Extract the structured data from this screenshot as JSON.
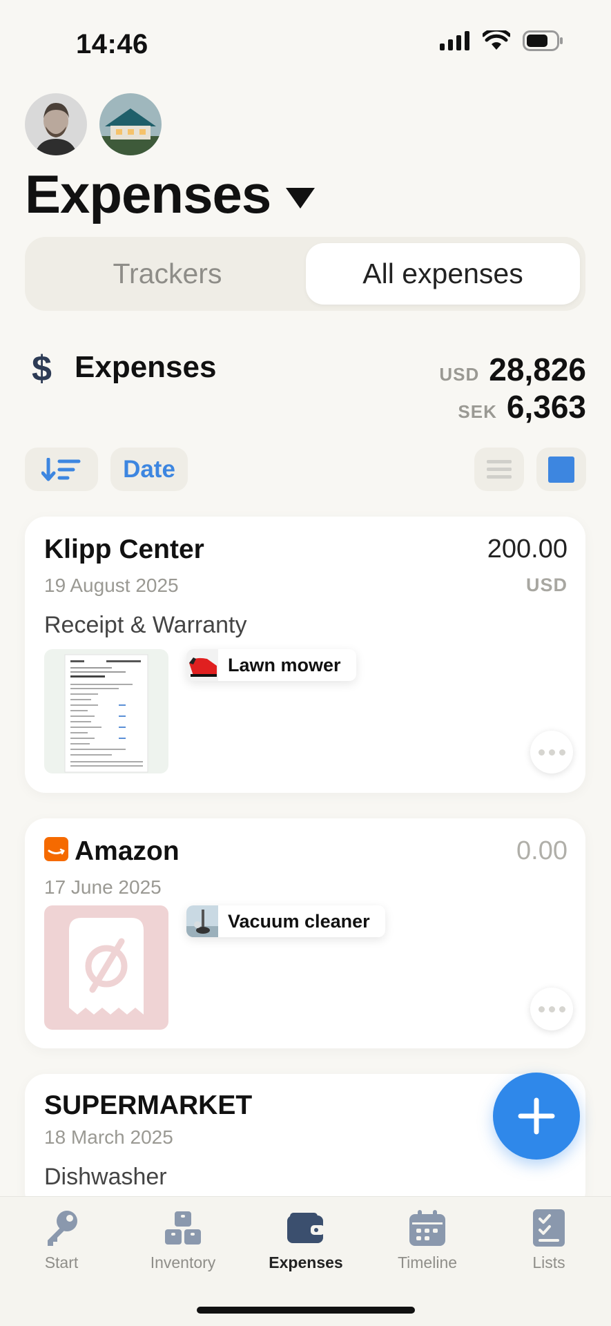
{
  "status_bar": {
    "time": "14:46"
  },
  "header": {
    "title": "Expenses"
  },
  "segments": {
    "trackers": "Trackers",
    "all_expenses": "All expenses",
    "active": "all_expenses"
  },
  "summary": {
    "icon": "dollar-icon",
    "label": "Expenses",
    "totals": [
      {
        "currency": "USD",
        "amount": "28,826"
      },
      {
        "currency": "SEK",
        "amount": "6,363"
      }
    ]
  },
  "controls": {
    "sort_icon": "sort-descending-icon",
    "sort_label": "Date",
    "view_list_icon": "list-view-icon",
    "view_grid_icon": "grid-view-icon"
  },
  "expenses": [
    {
      "merchant": "Klipp Center",
      "date": "19 August 2025",
      "amount": "200.00",
      "currency": "USD",
      "note": "Receipt & Warranty",
      "tag": "Lawn mower"
    },
    {
      "merchant": "Amazon",
      "date": "17 June 2025",
      "amount": "0.00",
      "currency": "",
      "note": "",
      "tag": "Vacuum cleaner"
    },
    {
      "merchant": "SUPERMARKET",
      "date": "18 March 2025",
      "amount": "",
      "currency": "",
      "note": "Dishwasher",
      "tag": ""
    }
  ],
  "tabbar": {
    "tabs": [
      {
        "label": "Start",
        "icon": "key-icon"
      },
      {
        "label": "Inventory",
        "icon": "boxes-icon"
      },
      {
        "label": "Expenses",
        "icon": "wallet-icon"
      },
      {
        "label": "Timeline",
        "icon": "calendar-icon"
      },
      {
        "label": "Lists",
        "icon": "checklist-icon"
      }
    ],
    "active": "Expenses"
  },
  "colors": {
    "background": "#f8f7f3",
    "accent": "#2f88ea",
    "amazon": "#f56a00"
  }
}
